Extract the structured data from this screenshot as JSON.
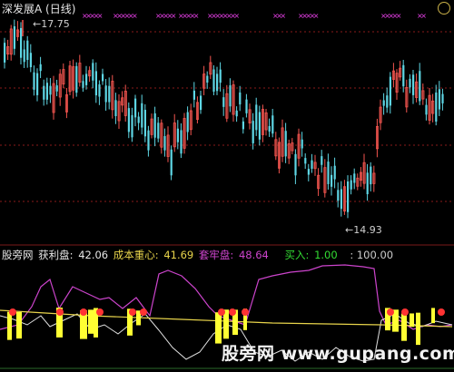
{
  "price_panel": {
    "title": "深发展A (日线)",
    "high_label": "17.75",
    "low_label": "14.93"
  },
  "indicator_panel": {
    "site_name": "股旁网",
    "profit_label": "获利盘:",
    "profit_value": "42.06",
    "cost_label": "成本重心:",
    "cost_value": "41.69",
    "trapped_label": "套牢盘:",
    "trapped_value": "48.64",
    "buy_label": "买入:",
    "buy_value": "1.00",
    "scale_value": ": 100.00"
  },
  "watermark": "股旁网 www.gupang.com",
  "colors": {
    "up_candle": "#f4554f",
    "down_candle": "#5ed6e4",
    "grid": "#8a1a1a",
    "profit_line": "#e0e0e0",
    "cost_line": "#e8d44b",
    "trapped_line": "#cc44cc",
    "buy_marker": "#ff3333",
    "signal_bar": "#ffff33",
    "xmark": "#e63fe6"
  }
}
